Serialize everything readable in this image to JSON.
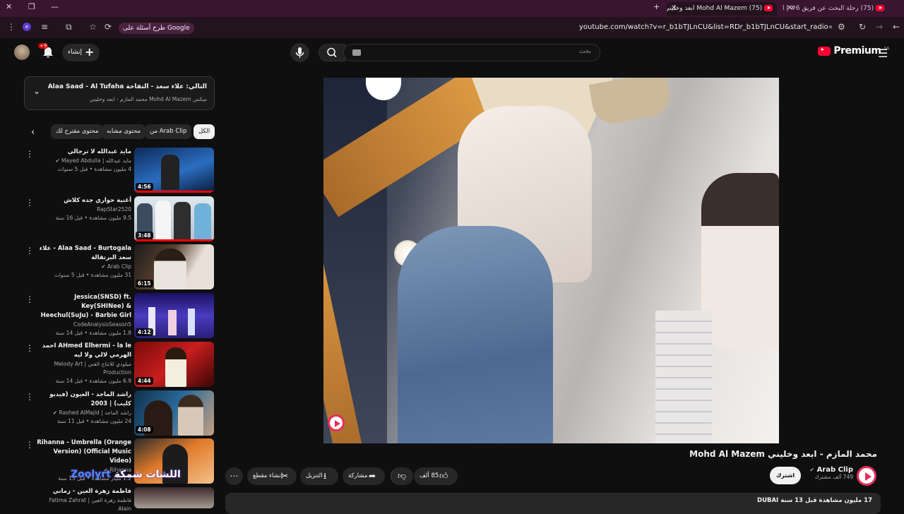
{
  "browser": {
    "tabs": [
      {
        "label": "(75) Mohd Al Mazem ابعد وخليني",
        "active": true
      },
      {
        "label": "(75) رحلة البحث عن فريق 6# | الا",
        "active": false
      }
    ],
    "url": "youtube.com/watch?v=r_b1bTJLnCU&list=RDr_b1bTJLnCU&start_radio=1",
    "google_chip": "طرح أسئلة على Google"
  },
  "youtube": {
    "logo": "Premium",
    "logo_badge": "SA",
    "search_placeholder": "بحث",
    "create_label": "إنشاء",
    "notifications_badge": "+9"
  },
  "up_next": {
    "title": "التالي: علاء سعد - التفاحة Alaa Saad - Al Tufaha",
    "subtitle": "ميكس Mohd Al Mazem محمد المازم - ابعد وخليني"
  },
  "filter_chips": [
    "الكل",
    "من Arab Clip",
    "محتوى مشابه",
    "محتوى مقترح لك"
  ],
  "recommendations": [
    {
      "title": "مايد عبدالله  لا ترجالي",
      "channel": "مايد عبدالله | Mayed Abdulla",
      "verified": true,
      "stats": "4 مليون مشاهدة • قبل 5 سنوات",
      "duration": "4:56",
      "progress": 1.0
    },
    {
      "title": "أغنية حواري جده كلاش",
      "channel": "RapStar2520",
      "verified": false,
      "stats": "9.5 مليون مشاهدة • قبل 16 سنة",
      "duration": "3:48",
      "progress": 1.0
    },
    {
      "title": "Alaa Saad - Burtogala - علاء سعد البرتقالة",
      "channel": "Arab Clip",
      "verified": true,
      "stats": "31 مليون مشاهدة • قبل 5 سنوات",
      "duration": "6:15",
      "progress": 0
    },
    {
      "title": "Jessica(SNSD) ft. Key(SHINee) & Heechul(SuJu) - Barbie Girl",
      "channel": "CodeAnalysisSeason5",
      "verified": false,
      "stats": "1.8 مليون مشاهدة • قبل 14 سنة",
      "duration": "4:12",
      "progress": 0
    },
    {
      "title": "AHmed Elhermi - la le احمد الهرمي لالي ولا ليه",
      "channel": "ميلودي للانتاج الفني | Melody Art Production",
      "verified": false,
      "stats": "6.9 مليون مشاهدة • قبل 14 سنة",
      "duration": "4:44",
      "progress": 0
    },
    {
      "title": "راشد الماجد - العيون (فيديو كليب) | 2003",
      "channel": "راشد الماجد | Rashed AlMajid",
      "verified": true,
      "stats": "24 مليون مشاهدة • قبل 11 سنة",
      "duration": "4:08",
      "progress": 0
    },
    {
      "title": "Rihanna - Umbrella (Orange Version) (Official Music Video)",
      "channel": "Rihanna",
      "verified": true,
      "stats": "1.2 مليار مشاهدة • قبل 15 سنة",
      "duration": "",
      "progress": 0
    },
    {
      "title": "فاطمة زهرة العين - زماني",
      "channel": "فاطمة زهرة العين | Fatima Zahrat Alain",
      "verified": false,
      "stats": "",
      "duration": "",
      "progress": 0
    }
  ],
  "overlay_text": {
    "arabic": "اللشات شمكة",
    "latin": "Zoolyrt"
  },
  "video": {
    "title": "محمد المازم - ابعد وخليني Mohd Al Mazem",
    "channel": "Arab Clip",
    "subscribers": "749 ألف مشترك",
    "subscribe_label": "اشترك",
    "likes": "85 ألف",
    "share_label": "مشاركة",
    "download_label": "التنزيل",
    "clip_label": "إنشاء مقطع",
    "description": "17 مليون مشاهدة  قبل 13 سنة  DUBAI"
  },
  "colors": {
    "accent": "#ff0000",
    "tab_bar": "#3a1530",
    "toolbar": "#22131c",
    "background": "#0f0f0f"
  }
}
